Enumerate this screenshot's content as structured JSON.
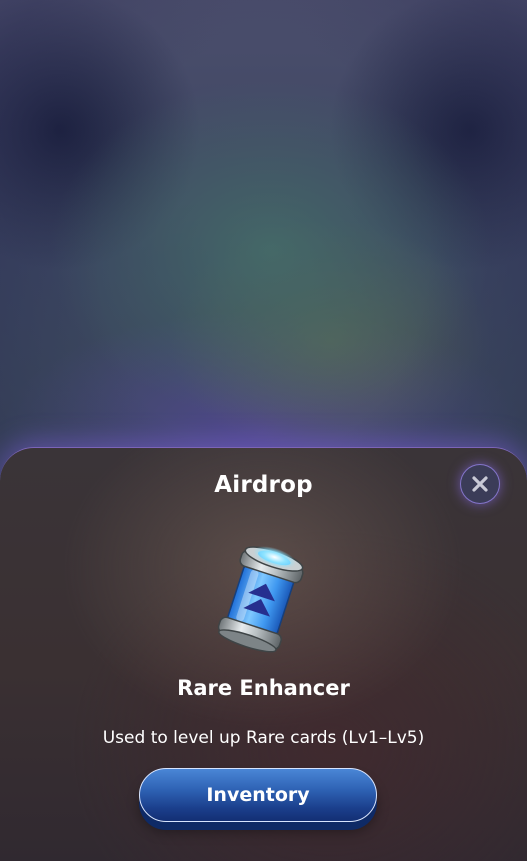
{
  "popup": {
    "title": "Airdrop",
    "close_icon": "close-icon"
  },
  "item": {
    "icon": "rare-enhancer-canister-icon",
    "name": "Rare Enhancer",
    "description": "Used to level up Rare cards (Lv1–Lv5)"
  },
  "actions": {
    "inventory_label": "Inventory"
  },
  "colors": {
    "sheet_border": "#9678e6",
    "button_primary": "#2e62b4",
    "button_shadow": "#0e2a66",
    "text": "#ffffff"
  }
}
